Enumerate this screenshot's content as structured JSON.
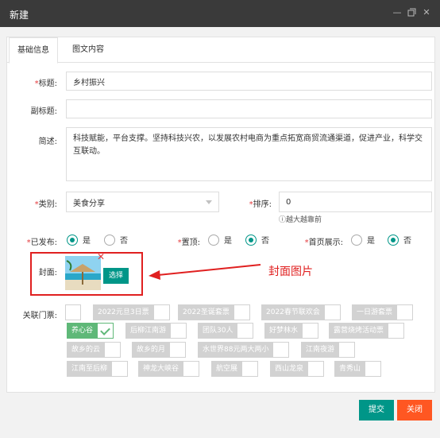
{
  "window": {
    "title": "新建"
  },
  "tabs": [
    "基础信息",
    "图文内容"
  ],
  "form": {
    "title": {
      "label": "标题:",
      "value": "乡村振兴"
    },
    "subtitle": {
      "label": "副标题:",
      "value": ""
    },
    "desc": {
      "label": "简述:",
      "value": "科技赋能，平台支撑。坚持科技兴农，以发展农村电商为重点拓宽商贸流通渠道，促进产业，科学交互联动。"
    },
    "category": {
      "label": "类别:",
      "value": "美食分享"
    },
    "sort": {
      "label": "排序:",
      "value": "0",
      "hint": "越大越靠前"
    },
    "published": {
      "label": "已发布:",
      "yes": "是",
      "no": "否",
      "selected": "是"
    },
    "pinned": {
      "label": "置顶:",
      "yes": "是",
      "no": "否",
      "selected": "否"
    },
    "homepage": {
      "label": "首页展示:",
      "yes": "是",
      "no": "否",
      "selected": "否"
    },
    "cover": {
      "label": "封面:",
      "select_label": "选择",
      "annotation": "封面图片"
    },
    "tickets": {
      "label": "关联门票:",
      "items": [
        {
          "name": "2022元旦3日票",
          "checked": false
        },
        {
          "name": "2022圣诞套票",
          "checked": false
        },
        {
          "name": "2022春节联欢会",
          "checked": false
        },
        {
          "name": "一日游套票",
          "checked": false
        },
        {
          "name": "养心谷",
          "checked": true
        },
        {
          "name": "后柳江南游",
          "checked": false
        },
        {
          "name": "团队30人",
          "checked": false
        },
        {
          "name": "好梦林水",
          "checked": false
        },
        {
          "name": "露营烧烤活动票",
          "checked": false
        },
        {
          "name": "故乡的云",
          "checked": false
        },
        {
          "name": "故乡的月",
          "checked": false
        },
        {
          "name": "水世界88元两大两小",
          "checked": false
        },
        {
          "name": "江南夜游",
          "checked": false
        },
        {
          "name": "江南至后柳",
          "checked": false
        },
        {
          "name": "神龙大峡谷",
          "checked": false
        },
        {
          "name": "航空展",
          "checked": false
        },
        {
          "name": "西山龙泉",
          "checked": false
        },
        {
          "name": "青秀山",
          "checked": false
        }
      ]
    }
  },
  "actions": {
    "submit": "提交",
    "close": "关闭"
  },
  "colors": {
    "accent": "#009688",
    "close_button": "#ff5722",
    "annotation": "#e02020",
    "tag_checked": "#5fb878"
  },
  "icons": {
    "minimize": "minimize-icon",
    "maximize": "maximize-icon",
    "close": "close-icon"
  }
}
